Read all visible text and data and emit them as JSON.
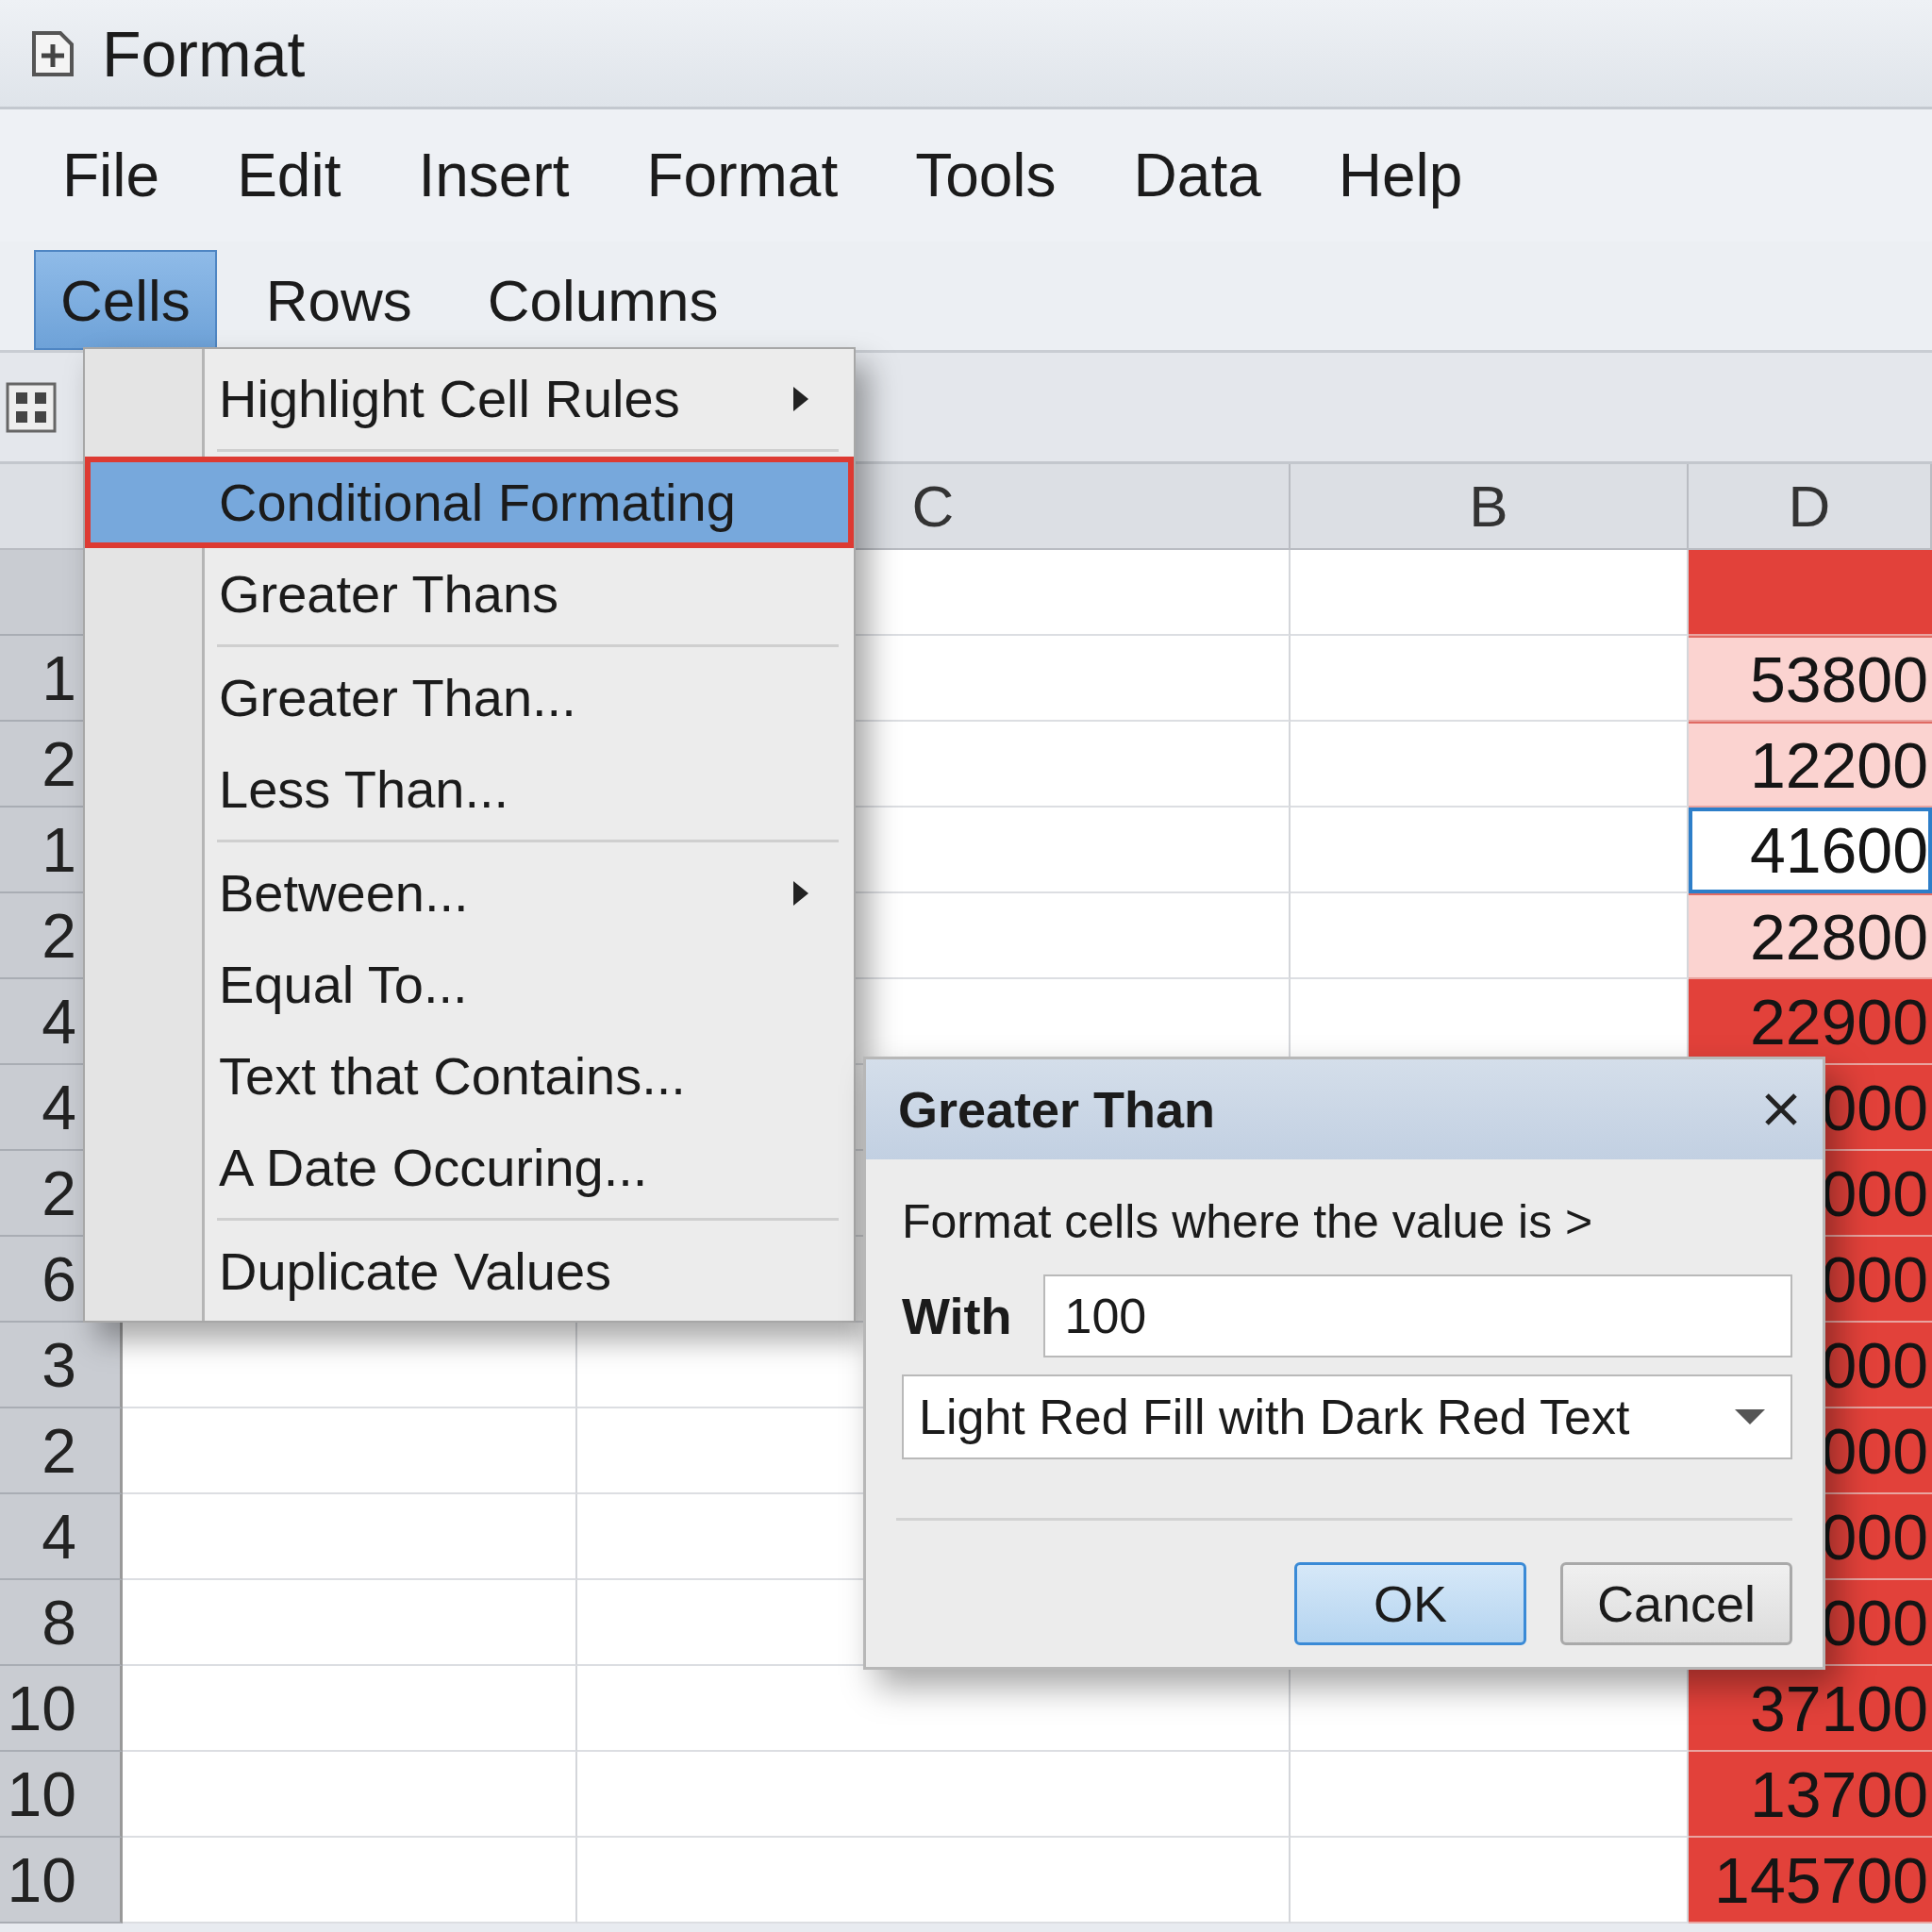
{
  "window": {
    "title": "Format"
  },
  "menu_bar": [
    "File",
    "Edit",
    "Insert",
    "Format",
    "Tools",
    "Data",
    "Help"
  ],
  "tabs": [
    {
      "label": "Cells",
      "selected": true
    },
    {
      "label": "Rows",
      "selected": false
    },
    {
      "label": "Columns",
      "selected": false
    }
  ],
  "sheet": {
    "columns": [
      "C",
      "B",
      "D"
    ],
    "rows": [
      {
        "kind": "strong",
        "selected": false
      },
      {
        "header": "1",
        "d": "53800",
        "kind": "light",
        "selected": false
      },
      {
        "header": "2",
        "d": "12200",
        "kind": "light",
        "selected": false
      },
      {
        "header": "1",
        "d": "41600",
        "kind": "plain",
        "selected": true
      },
      {
        "header": "2",
        "d": "22800",
        "kind": "light",
        "selected": false
      },
      {
        "header": "4",
        "d": "22900",
        "kind": "strong",
        "selected": false
      },
      {
        "header": "4",
        "d": "000",
        "kind": "strong",
        "selected": false
      },
      {
        "header": "2",
        "d": "000",
        "kind": "strong",
        "selected": false
      },
      {
        "header": "6",
        "d": "000",
        "kind": "strong",
        "selected": false
      },
      {
        "header": "3",
        "d": "000",
        "kind": "strong",
        "selected": false
      },
      {
        "header": "2",
        "d": "000",
        "kind": "strong",
        "selected": false
      },
      {
        "header": "4",
        "d": "000",
        "kind": "strong",
        "selected": false
      },
      {
        "header": "8",
        "d": "000",
        "kind": "strong",
        "selected": false
      },
      {
        "header": "10",
        "d": "37100",
        "kind": "strong",
        "selected": false
      },
      {
        "header": "10",
        "d": "13700",
        "kind": "strong",
        "selected": false
      },
      {
        "header": "10",
        "d": "145700",
        "kind": "strong",
        "selected": false
      }
    ]
  },
  "context_menu": {
    "groups": [
      [
        {
          "label": "Highlight Cell Rules",
          "submenu": true,
          "selected": false
        }
      ],
      [
        {
          "label": "Conditional Formating",
          "submenu": false,
          "selected": true
        },
        {
          "label": "Greater Thans",
          "submenu": false,
          "selected": false
        }
      ],
      [
        {
          "label": "Greater Than...",
          "submenu": false,
          "selected": false
        },
        {
          "label": "Less Than...",
          "submenu": false,
          "selected": false
        }
      ],
      [
        {
          "label": "Between...",
          "submenu": true,
          "selected": false
        },
        {
          "label": "Equal To...",
          "submenu": false,
          "selected": false
        },
        {
          "label": "Text that Contains...",
          "submenu": false,
          "selected": false
        },
        {
          "label": "A Date Occuring...",
          "submenu": false,
          "selected": false
        }
      ],
      [
        {
          "label": "Duplicate Values",
          "submenu": false,
          "selected": false
        }
      ]
    ]
  },
  "dialog": {
    "title": "Greater Than",
    "prompt": "Format cells where the value is >",
    "with_label": "With",
    "value": "100",
    "format": "Light Red Fill with Dark Red Text",
    "buttons": [
      {
        "label": "OK",
        "default": true
      },
      {
        "label": "Cancel",
        "default": false
      }
    ]
  }
}
